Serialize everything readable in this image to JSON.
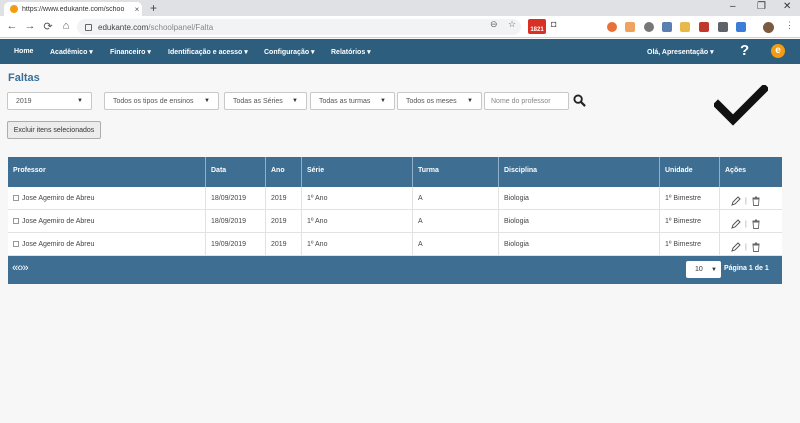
{
  "browser": {
    "tab_title": "https://www.edukante.com/schoo",
    "tab_close": "×",
    "new_tab": "+",
    "window_controls": [
      "–",
      "❐",
      "✕"
    ],
    "nav": [
      "←",
      "→",
      "⟳",
      "⌂"
    ],
    "url_domain": "edukante.com",
    "url_path": "/schoolpanel/Falta",
    "zoom_icon": "⊖",
    "star_icon": "☆",
    "badge": "1821",
    "camera_icon": "◘"
  },
  "navbar": {
    "items": [
      {
        "label": "Home"
      },
      {
        "label": "Acadêmico ▾"
      },
      {
        "label": "Financeiro ▾"
      },
      {
        "label": "Identificação e acesso ▾"
      },
      {
        "label": "Configuração ▾"
      },
      {
        "label": "Relatórios ▾"
      }
    ],
    "user": "Olá, Apresentação ▾",
    "help": "?",
    "logo": "e"
  },
  "page": {
    "title": "Faltas"
  },
  "filters": {
    "year": "2019",
    "teaching_types": "Todos os tipos de ensinos",
    "series": "Todas as Séries",
    "classes": "Todas as turmas",
    "months": "Todos os meses",
    "professor_placeholder": "Nome do professor"
  },
  "actions": {
    "delete_selected": "Excluir itens selecionados"
  },
  "table": {
    "headers": [
      "Professor",
      "Data",
      "Ano",
      "Série",
      "Turma",
      "Disciplina",
      "Unidade",
      "Ações"
    ],
    "rows": [
      {
        "professor": "Jose Agemiro de Abreu",
        "data": "18/09/2019",
        "ano": "2019",
        "serie": "1º Ano",
        "turma": "A",
        "disciplina": "Biologia",
        "unidade": "1º Bimestre"
      },
      {
        "professor": "Jose Agemiro de Abreu",
        "data": "18/09/2019",
        "ano": "2019",
        "serie": "1º Ano",
        "turma": "A",
        "disciplina": "Biologia",
        "unidade": "1º Bimestre"
      },
      {
        "professor": "Jose Agemiro de Abreu",
        "data": "19/09/2019",
        "ano": "2019",
        "serie": "1º Ano",
        "turma": "A",
        "disciplina": "Biologia",
        "unidade": "1º Bimestre"
      }
    ],
    "action_separator": "|"
  },
  "pagination": {
    "controls": "«‹›»",
    "page_size": "10",
    "info": "Página 1 de 1"
  },
  "colors": {
    "navbar": "#2e5e7e",
    "table_header": "#3e6e92",
    "title": "#3a6f96",
    "logo": "#f39c12"
  }
}
